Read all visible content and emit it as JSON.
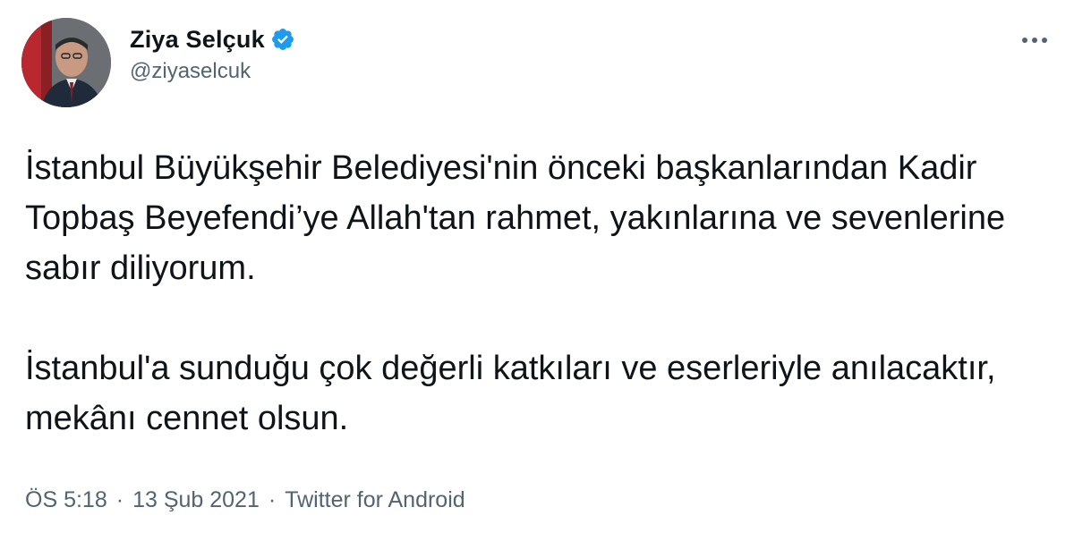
{
  "author": {
    "display_name": "Ziya Selçuk",
    "handle": "@ziyaselcuk",
    "verified": true
  },
  "tweet": {
    "paragraphs": [
      "İstanbul Büyükşehir Belediyesi'nin önceki başkanlarından Kadir Topbaş Beyefendi’ye Allah'tan rahmet, yakınlarına ve sevenlerine sabır diliyorum.",
      "İstanbul'a sunduğu çok değerli katkıları ve eserleriyle anılacaktır, mekânı cennet olsun."
    ],
    "time": "ÖS 5:18",
    "separator": "·",
    "date": "13 Şub 2021",
    "source": "Twitter for Android"
  },
  "icons": {
    "verified": "verified-badge-icon",
    "more": "more-options-icon"
  },
  "colors": {
    "text_primary": "#0f1419",
    "text_secondary": "#536471",
    "verified_blue": "#1d9bf0"
  }
}
